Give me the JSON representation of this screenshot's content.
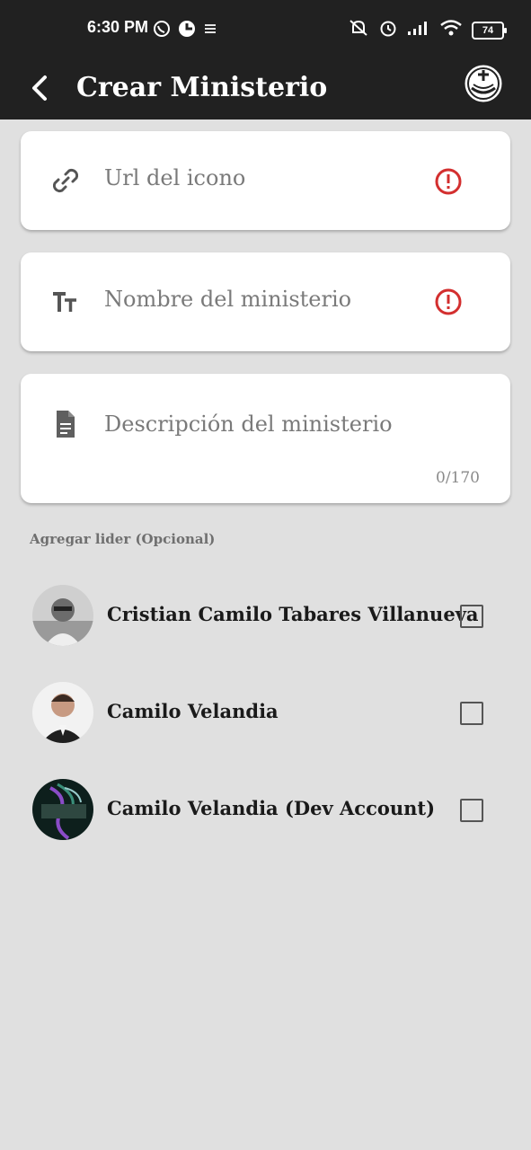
{
  "status_bar": {
    "time": "6:30 PM",
    "battery": "74",
    "left_icons": [
      "whatsapp-icon",
      "app-notification-icon",
      "menu-lines-icon"
    ],
    "right_icons": [
      "muted-bell-icon",
      "alarm-icon",
      "signal-icon",
      "wifi-icon",
      "battery-icon"
    ]
  },
  "appbar": {
    "title": "Crear Ministerio",
    "back_icon": "chevron-left-icon",
    "logo_icon": "church-logo-icon"
  },
  "form": {
    "icon_url": {
      "placeholder": "Url del icono",
      "icon": "link-icon",
      "error_icon": "error-icon"
    },
    "name": {
      "placeholder": "Nombre del ministerio",
      "icon": "text-size-icon",
      "error_icon": "error-icon"
    },
    "description": {
      "placeholder": "Descripción del ministerio",
      "icon": "document-icon",
      "counter": "0/170"
    }
  },
  "leaders_section": {
    "label": "Agregar lider (Opcional)",
    "items": [
      {
        "name": "Cristian Camilo Tabares Villanueva",
        "checked": false
      },
      {
        "name": "Camilo Velandia",
        "checked": false
      },
      {
        "name": "Camilo Velandia (Dev Account)",
        "checked": false
      }
    ]
  },
  "colors": {
    "appbar": "#212121",
    "background": "#e0e0e0",
    "error": "#d32f2f"
  }
}
